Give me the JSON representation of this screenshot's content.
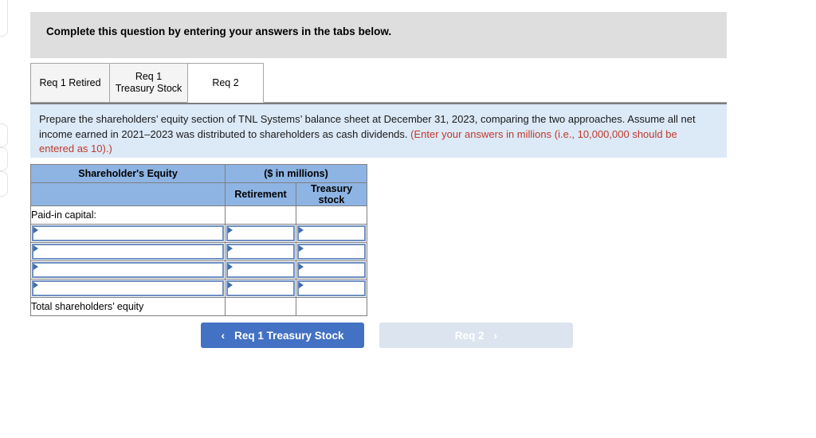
{
  "banner": {
    "text": "Complete this question by entering your answers in the tabs below."
  },
  "tabs": [
    {
      "label": "Req 1 Retired",
      "active": false
    },
    {
      "label": "Req 1 Treasury Stock",
      "active": false
    },
    {
      "label": "Req 2",
      "active": true
    }
  ],
  "requirement": {
    "body": "Prepare the shareholders’ equity section of TNL Systems’ balance sheet at December 31, 2023, comparing the two approaches. Assume all net income earned in 2021–2023 was distributed to shareholders as cash dividends. ",
    "note": "(Enter your answers in millions (i.e., 10,000,000 should be entered as 10).)"
  },
  "table": {
    "header_main": "Shareholder's Equity",
    "header_units": "($ in millions)",
    "col_retirement": "Retirement",
    "col_treasury": "Treasury stock",
    "section_label": "Paid-in capital:",
    "input_rows": [
      {
        "label": "",
        "retirement": "",
        "treasury": ""
      },
      {
        "label": "",
        "retirement": "",
        "treasury": ""
      },
      {
        "label": "",
        "retirement": "",
        "treasury": ""
      },
      {
        "label": "",
        "retirement": "",
        "treasury": ""
      }
    ],
    "total_label": "Total shareholders’ equity",
    "total_retirement": "",
    "total_treasury": ""
  },
  "nav": {
    "prev_label": "Req 1 Treasury Stock",
    "prev_chevron": "‹",
    "next_label": "Req 2",
    "next_chevron": "›"
  },
  "colors": {
    "banner_bg": "#dededf",
    "panel_bg": "#dce9f7",
    "header_blue": "#8eb4e3",
    "input_border": "#6e8fc0",
    "arrow_blue": "#3d6ead",
    "btn_active": "#4371c3",
    "btn_disabled": "#dce4ef",
    "note_red": "#c0392b"
  }
}
